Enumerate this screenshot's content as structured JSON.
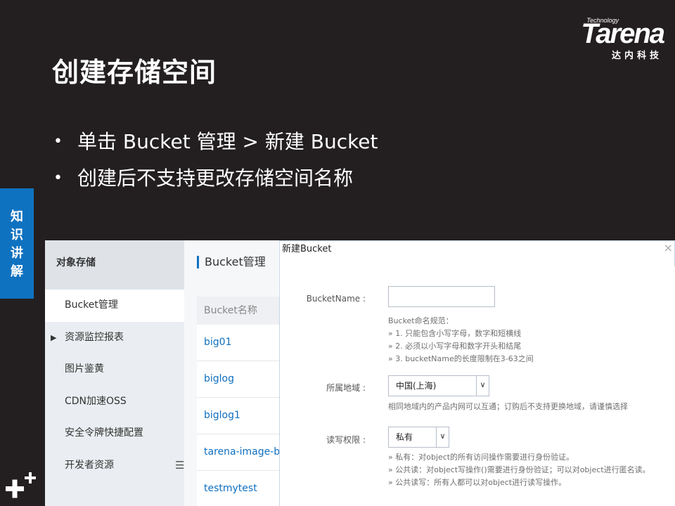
{
  "slide": {
    "title": "创建存储空间",
    "bullets": [
      "单击 Bucket 管理 > 新建 Bucket",
      "创建后不支持更改存储空间名称"
    ],
    "bullet_glyph": "•",
    "side_tab": [
      "知",
      "识",
      "讲",
      "解"
    ],
    "logo": {
      "tech": "Technology",
      "main": "Tarena",
      "sub": "达内科技"
    },
    "colors": {
      "background": "#231f20",
      "accent": "#0f72c0",
      "link": "#0f6fc0"
    }
  },
  "console": {
    "nav_header": "对象存储",
    "nav_items": [
      {
        "label": "Bucket管理",
        "arrow": ""
      },
      {
        "label": "资源监控报表",
        "arrow": "▶"
      },
      {
        "label": "图片鉴黄",
        "arrow": ""
      },
      {
        "label": "CDN加速OSS",
        "arrow": ""
      },
      {
        "label": "安全令牌快捷配置",
        "arrow": ""
      },
      {
        "label": "开发者资源",
        "arrow": ""
      }
    ],
    "collapse_icon": "☰",
    "section_title": "Bucket管理",
    "table_header": "Bucket名称",
    "buckets": [
      "big01",
      "biglog",
      "biglog1",
      "tarena-image-bucket",
      "testmytest"
    ]
  },
  "dialog": {
    "title": "新建Bucket",
    "close": "×",
    "name_label": "BucketName :",
    "name_value": "",
    "name_rules": [
      "Bucket命名规范：",
      "» 1. 只能包含小写字母，数字和短横线",
      "» 2. 必须以小写字母和数字开头和结尾",
      "» 3. bucketName的长度限制在3-63之间"
    ],
    "region_label": "所属地域 :",
    "region_value": "中国(上海)",
    "region_hint": "相同地域内的产品内网可以互通；订购后不支持更换地域，请谨慎选择",
    "acl_label": "读写权限 :",
    "acl_value": "私有",
    "acl_hints": [
      "» 私有：对object的所有访问操作需要进行身份验证。",
      "» 公共读：对object写操作()需要进行身份验证；可以对object进行匿名读。",
      "» 公共读写：所有人都可以对object进行读写操作。"
    ],
    "caret": "∨"
  }
}
